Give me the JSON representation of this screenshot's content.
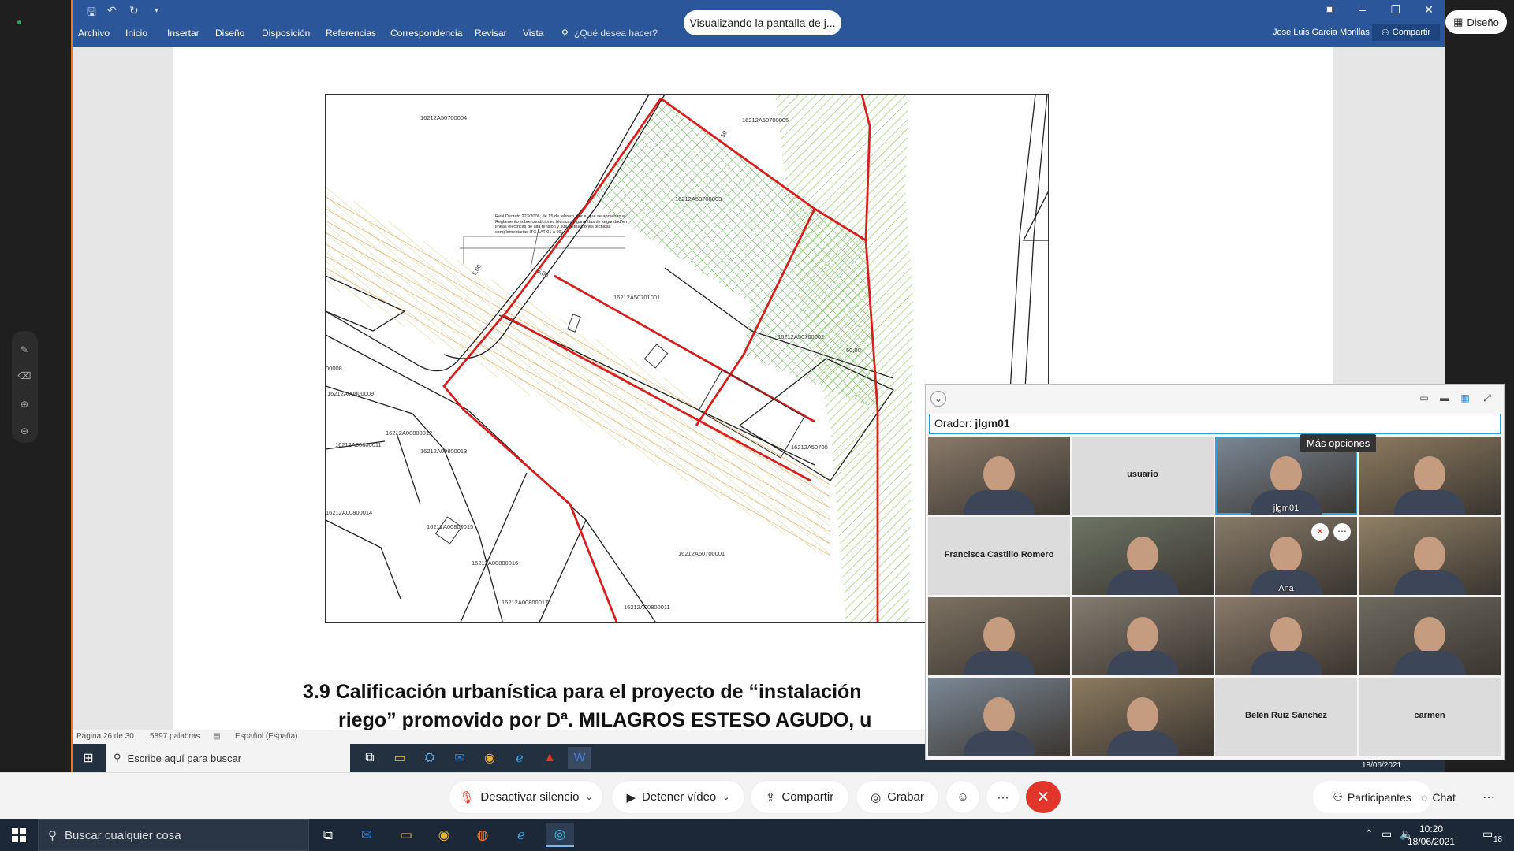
{
  "left_toolbar": {
    "icons": [
      "pen-icon",
      "eraser-icon",
      "zoom-in-icon",
      "zoom-out-icon"
    ]
  },
  "top_right": {
    "diseno_label": "Diseño"
  },
  "word": {
    "menu": [
      "Archivo",
      "Inicio",
      "Insertar",
      "Diseño",
      "Disposición",
      "Referencias",
      "Correspondencia",
      "Revisar",
      "Vista"
    ],
    "tell_me": "¿Qué desea hacer?",
    "sharing_banner": "Visualizando la pantalla de j...",
    "user_name": "Jose Luis Garcia Morillas",
    "share_label": "Compartir",
    "heading_line1": "3.9 Calificación urbanística para el proyecto de “instalación",
    "heading_line2": "riego” promovido por Dª. MILAGROS ESTESO AGUDO, u",
    "status": {
      "page": "Página 26 de 30",
      "words": "5897 palabras",
      "language": "Español (España)"
    },
    "map_labels": {
      "a": "16212A50700004",
      "b": "16212A50700005",
      "c": "16212A50700003",
      "d": "16212A50701001",
      "e": "16212A50700002",
      "f": "16212A00800009",
      "g": "16212A00800012",
      "h": "16212A00800011",
      "i": "16212A00800013",
      "j": "16212A00800014",
      "k": "16212A00800015",
      "l": "16212A00800016",
      "m": "16212A00800017",
      "n": "16212A50700001",
      "o": "16212A00800011",
      "p": "16212A50700",
      "q": "00008",
      "dim1": "5,00",
      "dim2": "5,00",
      "dim3": "50,00",
      "dim4": "50",
      "note": "Real Decreto 223/2008, de 15 de febrero, por el que se aprueban el Reglamento sobre condiciones técnicas y garantías de seguridad en líneas eléctricas de alta tensión y sus instrucciones técnicas complementarias ITC-LAT 01 a 09."
    }
  },
  "inner_taskbar": {
    "search": "Escribe aquí para buscar",
    "date": "18/06/2021"
  },
  "panel": {
    "speaker_prefix": "Orador:",
    "speaker_name": "jlgm01",
    "tooltip": "Más opciones",
    "tiles": [
      {
        "type": "video",
        "name": ""
      },
      {
        "type": "empty",
        "name": "usuario"
      },
      {
        "type": "video",
        "name": "jlgm01"
      },
      {
        "type": "video",
        "name": ""
      },
      {
        "type": "empty",
        "name": "Francisca Castillo Romero"
      },
      {
        "type": "video",
        "name": ""
      },
      {
        "type": "video",
        "name": "Ana"
      },
      {
        "type": "video",
        "name": ""
      },
      {
        "type": "video",
        "name": ""
      },
      {
        "type": "video",
        "name": ""
      },
      {
        "type": "video",
        "name": ""
      },
      {
        "type": "video",
        "name": ""
      },
      {
        "type": "video",
        "name": ""
      },
      {
        "type": "video",
        "name": ""
      },
      {
        "type": "empty",
        "name": "Belén Ruiz Sánchez"
      },
      {
        "type": "empty",
        "name": "carmen"
      }
    ]
  },
  "meeting_bar": {
    "mute": "Desactivar silencio",
    "video": "Detener vídeo",
    "share": "Compartir",
    "record": "Grabar",
    "participants": "Participantes",
    "chat": "Chat"
  },
  "taskbar": {
    "search": "Buscar cualquier cosa",
    "time": "10:20",
    "date": "18/06/2021",
    "notifications": "18"
  }
}
